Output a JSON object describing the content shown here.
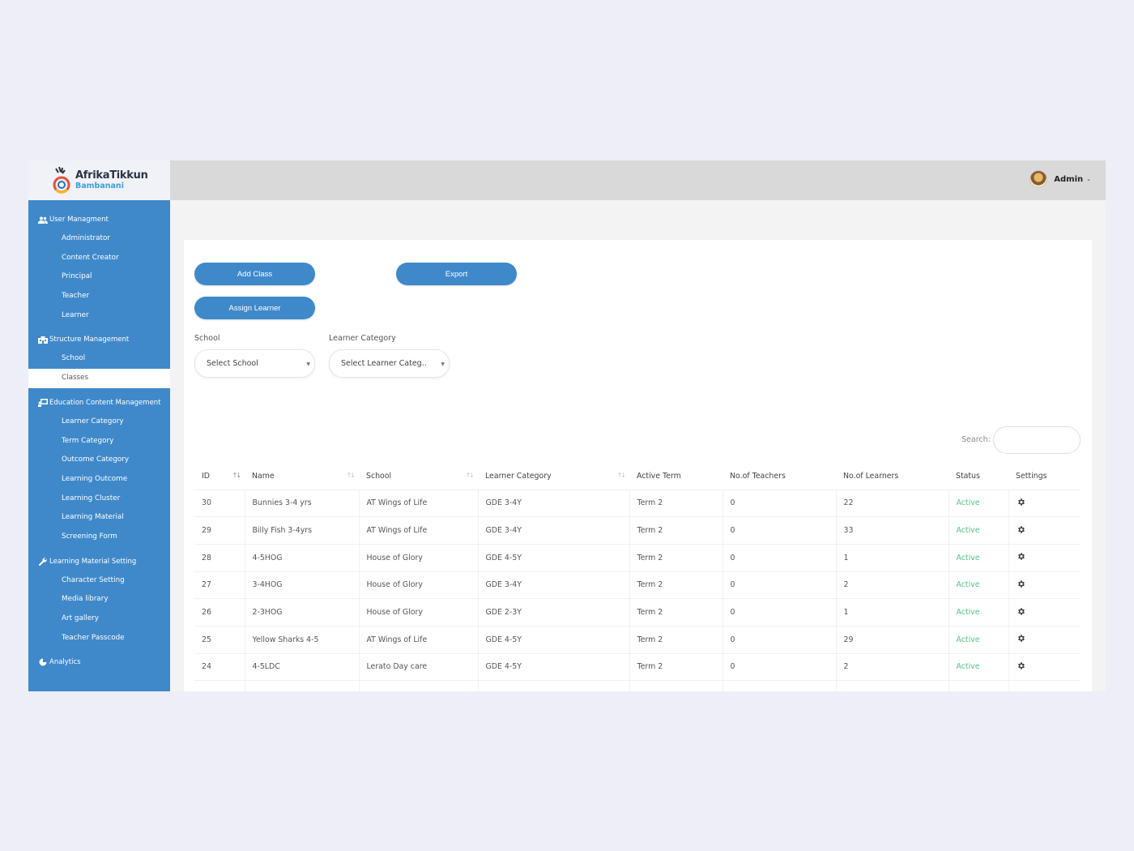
{
  "brand": {
    "name": "AfrikaTikkun",
    "sub": "Bambanani"
  },
  "header": {
    "user_name": "Admin",
    "avatar": "admin-avatar"
  },
  "sidebar": {
    "sections": [
      {
        "label": "User Managment",
        "icon": "users-icon",
        "items": [
          "Administrator",
          "Content Creator",
          "Principal",
          "Teacher",
          "Learner"
        ]
      },
      {
        "label": "Structure Management",
        "icon": "building-icon",
        "items": [
          "School",
          "Classes"
        ]
      },
      {
        "label": "Education Content Management",
        "icon": "chalkboard-icon",
        "items": [
          "Learner Category",
          "Term Category",
          "Outcome Category",
          "Learning Outcome",
          "Learning Cluster",
          "Learning Material",
          "Screening Form"
        ]
      },
      {
        "label": "Learning Material Setting",
        "icon": "wrench-icon",
        "items": [
          "Character Setting",
          "Media library",
          "Art gallery",
          "Teacher Passcode"
        ]
      },
      {
        "label": "Analytics",
        "icon": "pie-chart-icon",
        "items": []
      }
    ],
    "active_item": "Classes"
  },
  "toolbar": {
    "add_class": "Add Class",
    "export": "Export",
    "assign_learner": "Assign Learner"
  },
  "filters": {
    "school_label": "School",
    "school_value": "Select School",
    "category_label": "Learner Category",
    "category_value": "Select Learner Categ.."
  },
  "search": {
    "label": "Search:",
    "value": ""
  },
  "table": {
    "columns": [
      "ID",
      "Name",
      "School",
      "Learner Category",
      "Active Term",
      "No.of Teachers",
      "No.of Learners",
      "Status",
      "Settings"
    ],
    "rows": [
      {
        "id": "30",
        "name": "Bunnies 3-4 yrs",
        "school": "AT Wings of Life",
        "category": "GDE 3-4Y",
        "term": "Term 2",
        "teachers": "0",
        "learners": "22",
        "status": "Active"
      },
      {
        "id": "29",
        "name": "Billy Fish 3-4yrs",
        "school": "AT Wings of Life",
        "category": "GDE 3-4Y",
        "term": "Term 2",
        "teachers": "0",
        "learners": "33",
        "status": "Active"
      },
      {
        "id": "28",
        "name": "4-5HOG",
        "school": "House of Glory",
        "category": "GDE 4-5Y",
        "term": "Term 2",
        "teachers": "0",
        "learners": "1",
        "status": "Active"
      },
      {
        "id": "27",
        "name": "3-4HOG",
        "school": "House of Glory",
        "category": "GDE 3-4Y",
        "term": "Term 2",
        "teachers": "0",
        "learners": "2",
        "status": "Active"
      },
      {
        "id": "26",
        "name": "2-3HOG",
        "school": "House of Glory",
        "category": "GDE 2-3Y",
        "term": "Term 2",
        "teachers": "0",
        "learners": "1",
        "status": "Active"
      },
      {
        "id": "25",
        "name": "Yellow Sharks 4-5",
        "school": "AT Wings of Life",
        "category": "GDE 4-5Y",
        "term": "Term 2",
        "teachers": "0",
        "learners": "29",
        "status": "Active"
      },
      {
        "id": "24",
        "name": "4-5LDC",
        "school": "Lerato Day care",
        "category": "GDE 4-5Y",
        "term": "Term 2",
        "teachers": "0",
        "learners": "2",
        "status": "Active"
      }
    ]
  },
  "colors": {
    "primary": "#3f89cb",
    "active_status": "#53c386",
    "header_bg": "#d9d9d9"
  }
}
